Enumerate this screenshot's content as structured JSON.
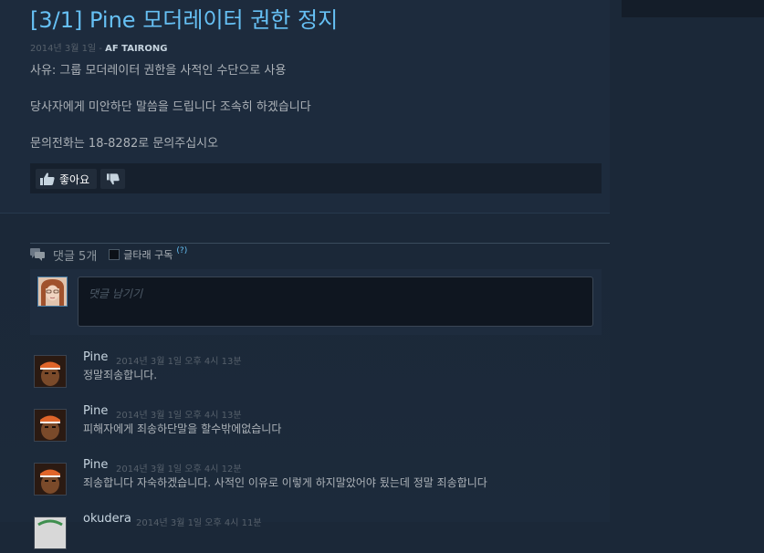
{
  "announcement": {
    "title": "[3/1] Pine 모더레이터 권한 정지",
    "date": "2014년 3월 1일",
    "separator": " - ",
    "author": "AF TAIRONG",
    "lines": [
      "사유: 그룹 모더레이터 권한을 사적인 수단으로 사용",
      "당사자에게 미안하단 말씀을 드립니다 조속히 하겠습니다",
      "문의전화는 18-8282로 문의주십시오"
    ],
    "like_label": "좋아요"
  },
  "comments_section": {
    "count_label": "댓글 5개",
    "subscribe_label": "글타래 구독",
    "help_label": "(?)",
    "input_placeholder": "댓글 남기기"
  },
  "comments": [
    {
      "author": "Pine",
      "timestamp": "2014년 3월 1일 오후 4시 13분",
      "text": "정말죄송합니다."
    },
    {
      "author": "Pine",
      "timestamp": "2014년 3월 1일 오후 4시 13분",
      "text": "피해자에게 죄송하단말을 할수밖에없습니다"
    },
    {
      "author": "Pine",
      "timestamp": "2014년 3월 1일 오후 4시 12분",
      "text": "죄송합니다 자숙하겠습니다. 사적인 이유로 이렇게 하지말았어야 됬는데 정말 죄송합니다"
    },
    {
      "author": "okudera",
      "timestamp": "2014년 3월 1일 오후 4시 11분",
      "text": ""
    }
  ],
  "colors": {
    "accent": "#66c0f4",
    "background": "#1b2838",
    "text": "#acb2b8"
  }
}
